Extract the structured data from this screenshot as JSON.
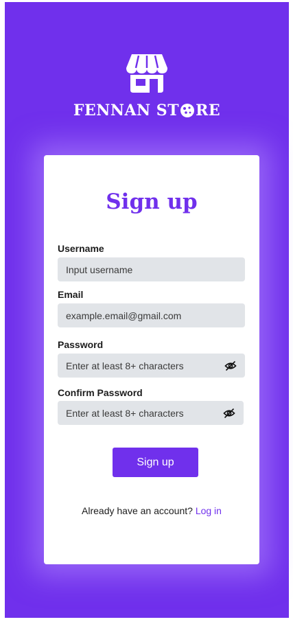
{
  "brand": {
    "name_before_icon": "FENNAN ST",
    "name_after_icon": "RE",
    "store_icon": "store-icon",
    "cookie_icon": "cookie-icon"
  },
  "colors": {
    "accent": "#7030ec",
    "field_bg": "#e1e4e8",
    "card_bg": "#ffffff"
  },
  "form": {
    "title": "Sign up",
    "fields": [
      {
        "label": "Username",
        "value": "",
        "placeholder": "Input username"
      },
      {
        "label": "Email",
        "value": "",
        "placeholder": "example.email@gmail.com"
      },
      {
        "label": "Password",
        "value": "",
        "placeholder": "Enter at least 8+ characters",
        "icon": "eye-slash-icon"
      },
      {
        "label": "Confirm Password",
        "value": "",
        "placeholder": "Enter at least 8+ characters",
        "icon": "eye-slash-icon"
      }
    ],
    "submit_label": "Sign up",
    "footer_text": "Already have an account?",
    "footer_link": "Log in"
  }
}
